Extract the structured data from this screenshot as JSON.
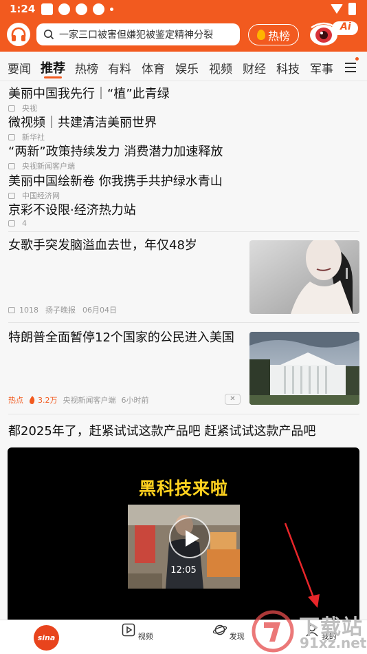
{
  "status": {
    "time": "1:24"
  },
  "search": {
    "placeholder": "一家三口被害但嫌犯被鉴定精神分裂"
  },
  "hot_button": {
    "label": "热榜"
  },
  "ai_badge": {
    "label": "Ai"
  },
  "tabs": [
    "要闻",
    "推荐",
    "热榜",
    "有料",
    "体育",
    "娱乐",
    "视频",
    "财经",
    "科技",
    "军事"
  ],
  "active_tab": "推荐",
  "headlines": [
    {
      "title": "美丽中国我先行｜“植”此青绿",
      "source": "央视"
    },
    {
      "title": "微视频｜共建清洁美丽世界",
      "source": "新华社"
    },
    {
      "title": "“两新”政策持续发力 消费潜力加速释放",
      "source": "央视新闻客户端"
    },
    {
      "title": "美丽中国绘新卷 你我携手共护绿水青山",
      "source": "中国经济网"
    },
    {
      "title": "京彩不设限·经济热力站",
      "source": "4"
    }
  ],
  "article1": {
    "title": "女歌手突发脑溢血去世，年仅48岁",
    "comments": "1018",
    "source": "扬子晚报",
    "date": "06月04日"
  },
  "article2": {
    "title": "特朗普全面暂停12个国家的公民进入美国",
    "tag": "热点",
    "heat": "3.2万",
    "source": "央视新闻客户端",
    "time": "6小时前"
  },
  "video_post": {
    "title": "都2025年了，赶紧试试这款产品吧 赶紧试试这款产品吧",
    "overlay_title": "黑科技来啦",
    "duration": "12:05"
  },
  "bottom_nav": {
    "logo": "sina",
    "video": "视频",
    "discover": "发现",
    "mine": "我的"
  },
  "watermark": {
    "line1": "下载站",
    "line2": "91xz.net"
  },
  "colors": {
    "brand": "#f25a1f",
    "overlay_yellow": "#ffd21f",
    "arrow": "#e8262a"
  }
}
